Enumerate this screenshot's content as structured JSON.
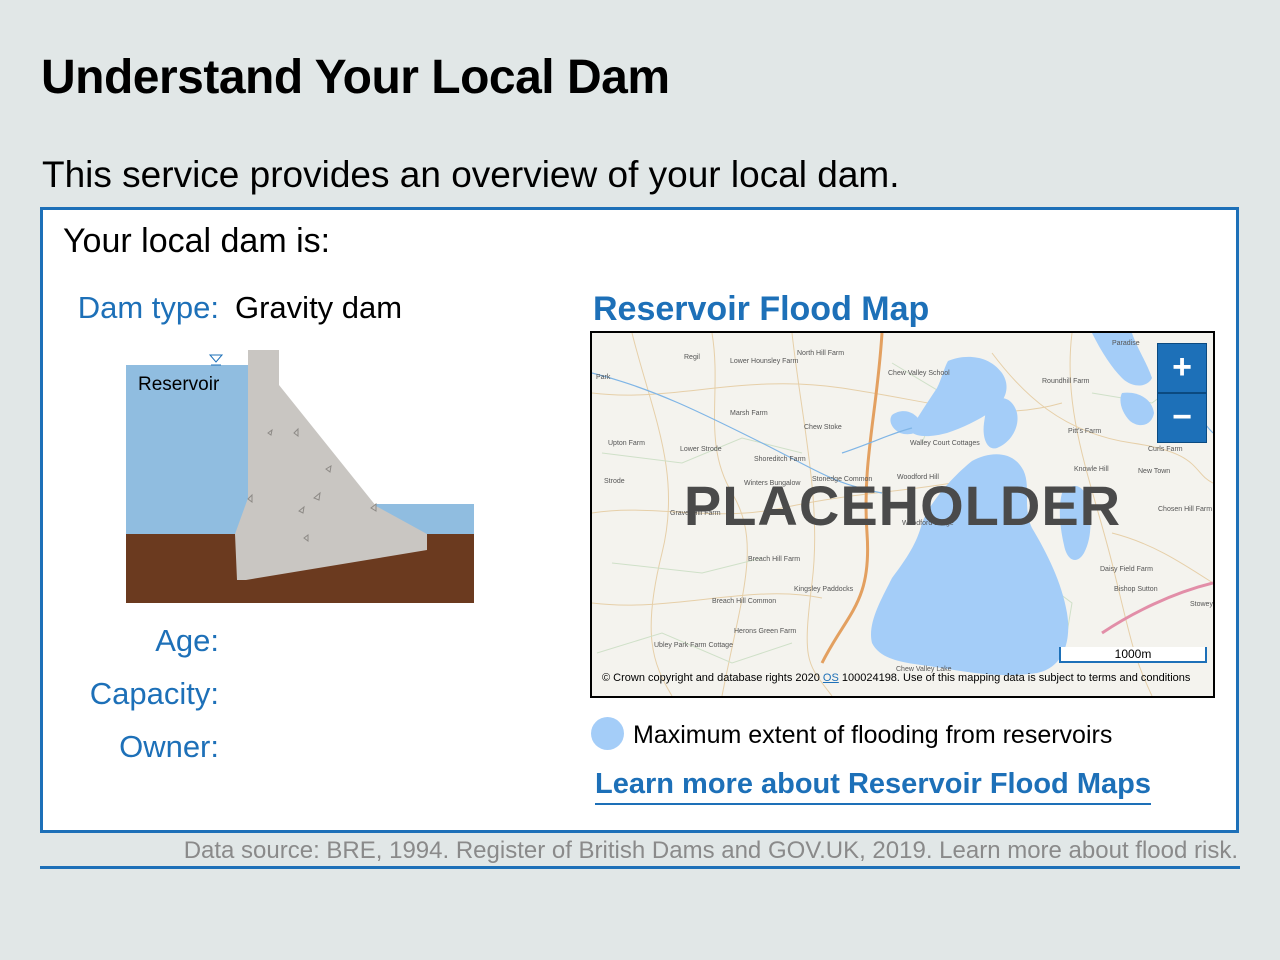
{
  "header": {
    "title": "Understand Your Local Dam",
    "intro": "This service provides an overview of your local dam."
  },
  "panel": {
    "heading": "Your local dam is:",
    "dam_type_label": "Dam type:",
    "dam_type_value": "Gravity dam",
    "age_label": "Age:",
    "capacity_label": "Capacity:",
    "owner_label": "Owner:",
    "diagram": {
      "reservoir_label": "Reservoir",
      "colors": {
        "water": "#90bde0",
        "dam": "#c9c6c2",
        "ground": "#6b3a1f"
      }
    }
  },
  "map": {
    "title": "Reservoir Flood Map",
    "placeholder": "PLACEHOLDER",
    "zoom_in": "+",
    "zoom_out": "−",
    "scale": "1000m",
    "attribution_prefix": "© Crown copyright and database rights 2020 ",
    "attribution_link": "OS",
    "attribution_suffix": " 100024198. Use of this mapping data is subject to terms and conditions",
    "place_names": [
      "Regil",
      "Lower Hounsley Farm",
      "North Hill Farm",
      "Chew Valley School",
      "Roundhill Farm",
      "Paradise",
      "Park",
      "Marsh Farm",
      "Chew Stoke",
      "Upton Farm",
      "Lower Strode",
      "Shoreditch Farm",
      "Walley Court Cottages",
      "Pitt's Farm",
      "Curls Farm",
      "Strode",
      "Winters Bungalow",
      "Stonedge Common",
      "Woodford Hill",
      "Knowle Hill",
      "New Town",
      "Gravel Hill Farm",
      "Chosen Hill Farm",
      "Breach Hill Farm",
      "Kingsley Paddocks",
      "Daisy Field Farm",
      "Bishop Sutton",
      "Breach Hill Common",
      "Herons Green Farm",
      "Ubley Park Farm Cottage",
      "Chew Valley Lake",
      "Stowey",
      "Woodford Lodge",
      "Chew Valley Lake"
    ],
    "flood_color": "#a4cdf8"
  },
  "legend": {
    "text": "Maximum extent of flooding from reservoirs"
  },
  "learn_more": "Learn more about Reservoir Flood Maps",
  "footer": {
    "source": "Data source: BRE, 1994. Register of British Dams and GOV.UK, 2019. Learn more about flood risk."
  }
}
